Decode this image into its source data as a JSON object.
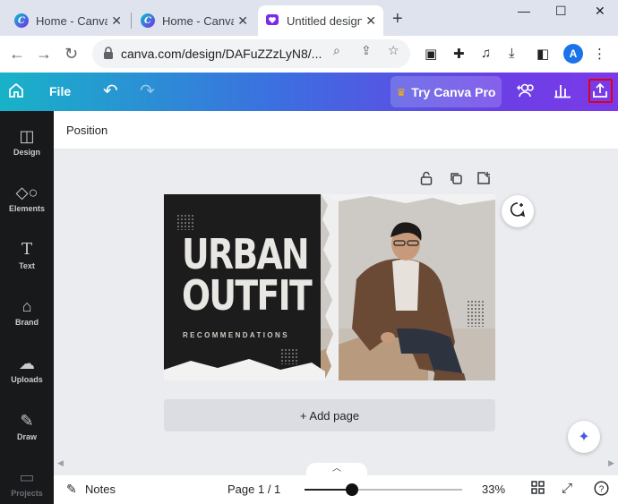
{
  "browser": {
    "tabs": [
      {
        "title": "Home - Canva",
        "icon": "canva-favicon"
      },
      {
        "title": "Home - Canva",
        "icon": "canva-favicon"
      },
      {
        "title": "Untitled design - Canva",
        "icon": "canva-heart-favicon",
        "active": true
      }
    ],
    "new_tab_label": "+",
    "url": "canva.com/design/DAFuZZzLyN8/...",
    "profile_initial": "A"
  },
  "header": {
    "file_label": "File",
    "try_pro_label": "Try Canva Pro",
    "gradient": [
      "#18b3c8",
      "#7b3ae8"
    ],
    "highlight_color": "#e0001b"
  },
  "sidebar": {
    "items": [
      {
        "label": "Design",
        "icon": "layout-icon"
      },
      {
        "label": "Elements",
        "icon": "shapes-icon"
      },
      {
        "label": "Text",
        "icon": "text-icon"
      },
      {
        "label": "Brand",
        "icon": "brand-kit-icon"
      },
      {
        "label": "Uploads",
        "icon": "cloud-upload-icon"
      },
      {
        "label": "Draw",
        "icon": "pen-icon"
      },
      {
        "label": "Projects",
        "icon": "folder-icon"
      }
    ]
  },
  "toolbar": {
    "position_label": "Position"
  },
  "design": {
    "headline_line1": "URBAN",
    "headline_line2": "OUTFIT",
    "subtitle": "RECOMMENDATIONS"
  },
  "canvas": {
    "add_page_label": "+ Add page"
  },
  "footer": {
    "notes_label": "Notes",
    "page_indicator": "Page 1 / 1",
    "zoom_label": "33%",
    "zoom_fraction": 0.3
  }
}
